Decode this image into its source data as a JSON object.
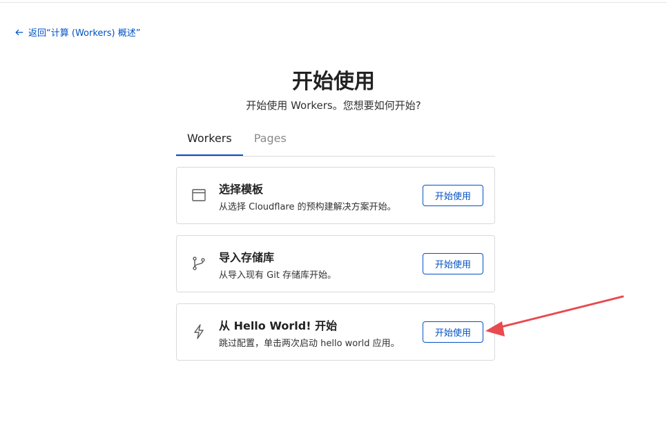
{
  "nav": {
    "back_label": "返回“计算 (Workers) 概述”"
  },
  "header": {
    "title": "开始使用",
    "subtitle": "开始使用 Workers。您想要如何开始?"
  },
  "tabs": [
    {
      "label": "Workers",
      "active": true
    },
    {
      "label": "Pages",
      "active": false
    }
  ],
  "cards": [
    {
      "icon": "browser-window-icon",
      "title": "选择模板",
      "description": "从选择 Cloudflare 的预构建解决方案开始。",
      "button": "开始使用"
    },
    {
      "icon": "git-branch-icon",
      "title": "导入存储库",
      "description": "从导入现有 Git 存储库开始。",
      "button": "开始使用"
    },
    {
      "icon": "lightning-bolt-icon",
      "title": "从 Hello World! 开始",
      "description": "跳过配置，单击两次启动 hello world 应用。",
      "button": "开始使用"
    }
  ],
  "colors": {
    "accent": "#0051c3",
    "annotation_arrow": "#e84a4f"
  }
}
